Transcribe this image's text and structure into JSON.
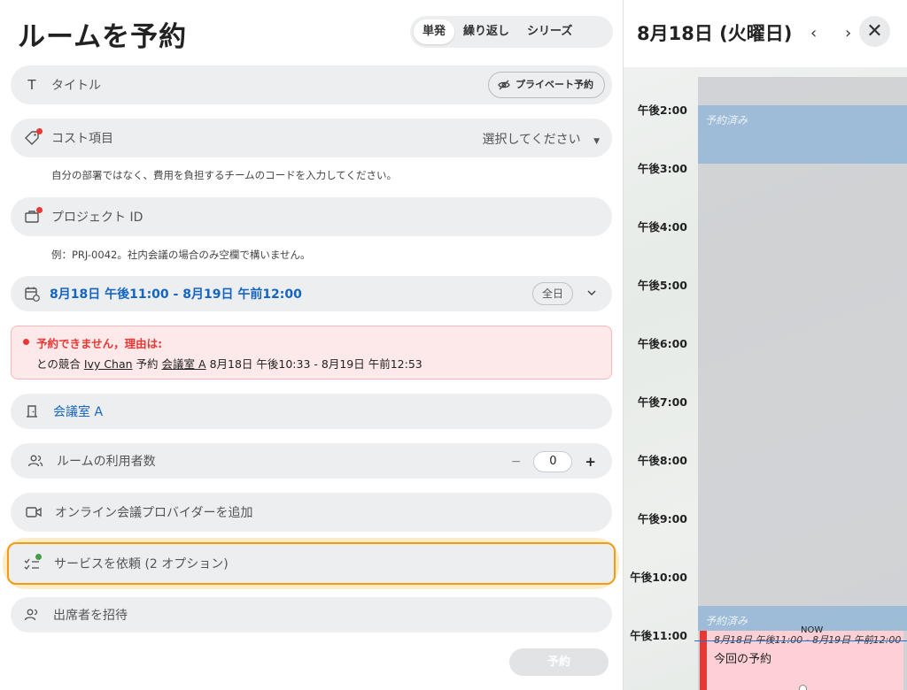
{
  "form": {
    "title": "ルームを予約",
    "modes": [
      "単発",
      "繰り返し",
      "シリーズ"
    ],
    "title_field": {
      "placeholder": "タイトル",
      "private_label": "プライベート予約"
    },
    "cost_field": {
      "label": "コスト項目",
      "select_value": "選択してください",
      "helper": "自分の部署ではなく、費用を負担するチームのコードを入力してください。"
    },
    "project_field": {
      "label": "プロジェクト ID",
      "helper": "例：PRJ-0042。社内会議の場合のみ空欄で構いません。"
    },
    "date_field": {
      "value": "8月18日 午後11:00 - 8月19日 午前12:00",
      "allday_label": "全日"
    },
    "error": {
      "heading": "予約できません，理由は:",
      "prefix": "との競合",
      "person": "Ivy Chan",
      "middle": "予約",
      "room": "会議室 A",
      "time": "8月18日 午後10:33 - 8月19日 午前12:53"
    },
    "room_field": {
      "value": "会議室 A"
    },
    "attendees_field": {
      "label": "ルームの利用者数",
      "value": "0",
      "minus": "−",
      "plus": "+"
    },
    "online_field": {
      "label": "オンライン会議プロバイダーを追加"
    },
    "service_field": {
      "label": "サービスを依頼 (2 オプション)"
    },
    "invite_field": {
      "label": "出席者を招待"
    },
    "book_button": "予約"
  },
  "calendar": {
    "title": "8月18日 (火曜日)",
    "prev": "‹",
    "next": "›",
    "close": "✕",
    "hours": [
      "午後2:00",
      "午後3:00",
      "午後4:00",
      "午後5:00",
      "午後6:00",
      "午後7:00",
      "午後8:00",
      "午後9:00",
      "午後10:00",
      "午後11:00"
    ],
    "booked_label": "予約済み",
    "now_label": "NOW",
    "current_event": {
      "time": "8月18日 午後11:00 - 8月19日 午前12:00",
      "title": "今回の予約"
    }
  },
  "colors": {
    "accent": "#1565c0",
    "error": "#e53935",
    "highlight": "#f39c12",
    "booked": "#8cb4d7",
    "current": "#fdd0d5"
  }
}
